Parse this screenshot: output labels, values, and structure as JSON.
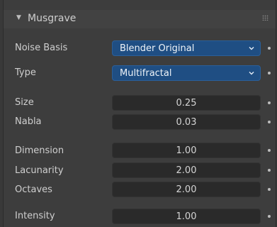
{
  "panel": {
    "title": "Musgrave",
    "collapse_icon": "triangle-down-icon",
    "grip_icon": "drag-grip-icon"
  },
  "rows": [
    {
      "label": "Noise Basis",
      "kind": "dropdown",
      "value": "Blender Original"
    },
    {
      "label": "Type",
      "kind": "dropdown",
      "value": "Multifractal"
    },
    {
      "label": "Size",
      "kind": "number",
      "value": "0.25"
    },
    {
      "label": "Nabla",
      "kind": "number",
      "value": "0.03"
    },
    {
      "label": "Dimension",
      "kind": "number",
      "value": "1.00"
    },
    {
      "label": "Lacunarity",
      "kind": "number",
      "value": "2.00"
    },
    {
      "label": "Octaves",
      "kind": "number",
      "value": "2.00"
    },
    {
      "label": "Intensity",
      "kind": "number",
      "value": "1.00"
    }
  ],
  "colors": {
    "dropdown_bg": "#1f4e83",
    "field_bg": "#2a2a2a",
    "panel_bg": "#3d3d3d"
  }
}
